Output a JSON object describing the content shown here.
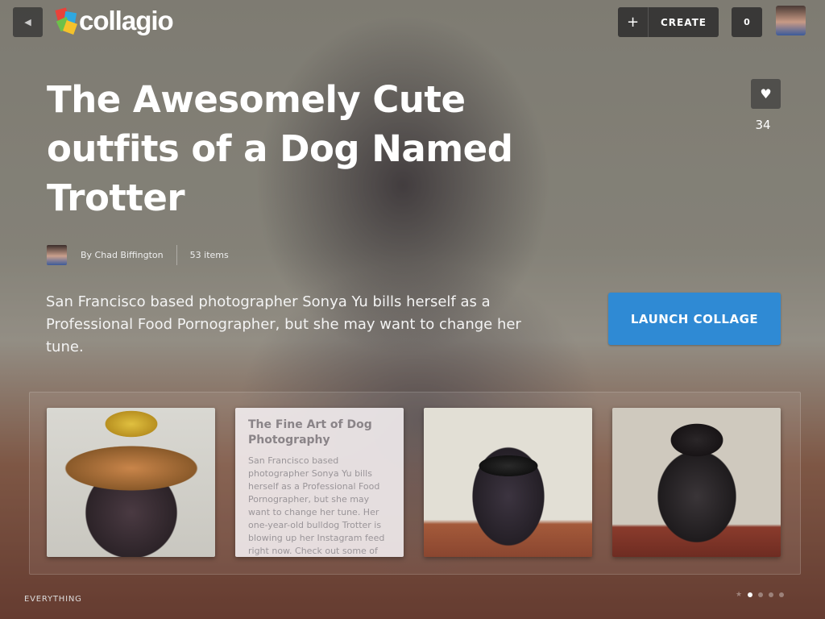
{
  "header": {
    "back_icon": "left-triangle-icon",
    "logo_text": "collagio",
    "create": {
      "icon": "plus-icon",
      "label": "CREATE"
    },
    "notification_count": "0"
  },
  "collage": {
    "title": "The Awesomely Cute outfits of a Dog Named Trotter",
    "like_icon": "heart-icon",
    "like_count": "34",
    "author": "By Chad Biffington",
    "item_count": "53 items",
    "description": "San Francisco based photographer Sonya Yu bills herself as a Professional Food Pornographer, but she may want to change her tune.",
    "launch_label": "LAUNCH COLLAGE"
  },
  "strip": {
    "text_card": {
      "heading": "The Fine Art of Dog Photography",
      "body": "San Francisco based photographer Sonya Yu bills herself as a Professional Food Pornographer, but she may want to change her tune.  Her one-year-old bulldog Trotter is blowing up her Instagram feed right now.  Check out some of"
    }
  },
  "footer": {
    "label": "EVERYTHING",
    "pager": {
      "total_dots": 5,
      "active_index": 0
    }
  },
  "colors": {
    "accent": "#2f8ad4"
  }
}
